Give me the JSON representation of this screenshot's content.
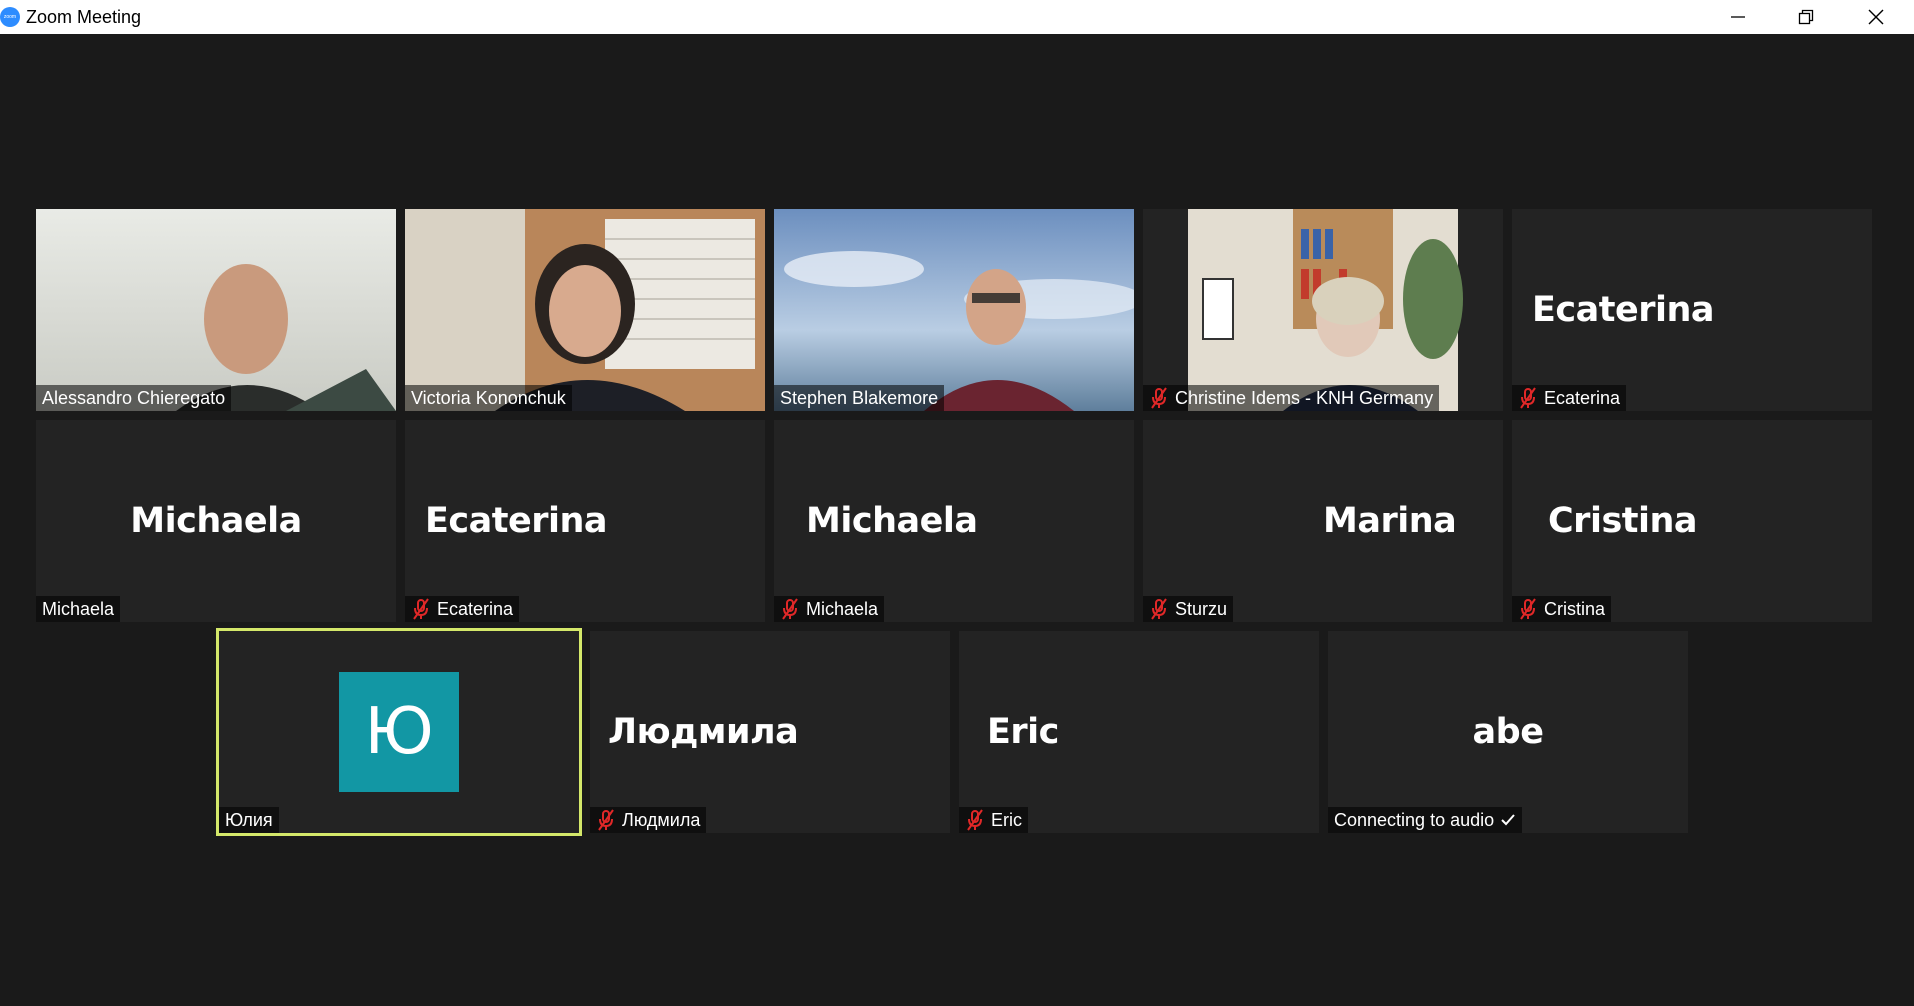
{
  "window": {
    "title": "Zoom Meeting",
    "logo_text": "zoom"
  },
  "tiles": [
    {
      "name_label": "Alessandro Chieregato",
      "muted": false,
      "type": "video"
    },
    {
      "name_label": "Victoria Kononchuk",
      "muted": false,
      "type": "video"
    },
    {
      "name_label": "Stephen Blakemore",
      "muted": false,
      "type": "video"
    },
    {
      "name_label": "Christine Idems - KNH Germany",
      "muted": true,
      "type": "video"
    },
    {
      "big_name": "Ecaterina",
      "name_label": "Ecaterina",
      "muted": true,
      "type": "name"
    },
    {
      "big_name": "Michaela",
      "name_label": "Michaela",
      "muted": false,
      "type": "name"
    },
    {
      "big_name": "Ecaterina",
      "name_label": "Ecaterina",
      "muted": true,
      "type": "name"
    },
    {
      "big_name": "Michaela",
      "name_label": "Michaela",
      "muted": true,
      "type": "name"
    },
    {
      "big_name": "Marina",
      "name_label": "Sturzu",
      "muted": true,
      "type": "name"
    },
    {
      "big_name": "Cristina",
      "name_label": "Cristina",
      "muted": true,
      "type": "name"
    },
    {
      "avatar_letter": "Ю",
      "name_label": "Юлия",
      "muted": false,
      "type": "avatar",
      "active_speaker": true
    },
    {
      "big_name": "Людмила",
      "name_label": "Людмила",
      "muted": true,
      "type": "name"
    },
    {
      "big_name": "Eric",
      "name_label": "Eric",
      "muted": true,
      "type": "name"
    },
    {
      "big_name": "abe",
      "name_label": "Connecting to audio",
      "muted": false,
      "type": "name"
    }
  ],
  "colors": {
    "background": "#1a1a1a",
    "tile": "#232323",
    "active_border": "#d4e86a",
    "mute_red": "#e02828",
    "avatar": "#1297a4"
  }
}
